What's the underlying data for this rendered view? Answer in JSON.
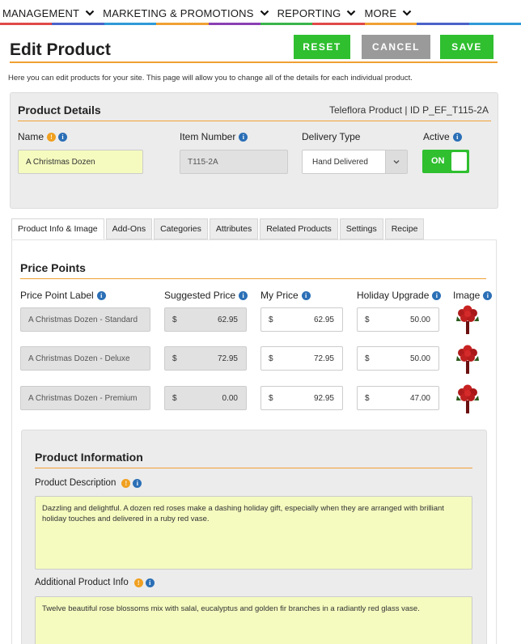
{
  "nav": {
    "items": [
      "MANAGEMENT",
      "MARKETING & PROMOTIONS",
      "REPORTING",
      "MORE"
    ],
    "colors": [
      "#e04848",
      "#4a62c8",
      "#2f9ad6",
      "#f0a033",
      "#8a3fb3",
      "#39b54a",
      "#e04848",
      "#f0a033",
      "#4a62c8",
      "#2f9ad6"
    ]
  },
  "header": {
    "title": "Edit Product",
    "reset_label": "RESET",
    "cancel_label": "CANCEL",
    "save_label": "SAVE",
    "intro": "Here you can edit products for your site. This page will allow you to change all of the details for each individual product."
  },
  "details": {
    "title": "Product Details",
    "meta": "Teleflora Product | ID P_EF_T115-2A",
    "name_label": "Name",
    "name_value": "A Christmas Dozen",
    "item_number_label": "Item Number",
    "item_number_value": "T115-2A",
    "delivery_label": "Delivery Type",
    "delivery_value": "Hand Delivered",
    "active_label": "Active",
    "active_value": "ON"
  },
  "tabs": [
    "Product Info & Image",
    "Add-Ons",
    "Categories",
    "Attributes",
    "Related Products",
    "Settings",
    "Recipe"
  ],
  "price_points": {
    "title": "Price Points",
    "headers": {
      "label": "Price Point Label",
      "suggested": "Suggested Price",
      "my_price": "My Price",
      "holiday": "Holiday Upgrade",
      "image": "Image"
    },
    "currency": "$",
    "rows": [
      {
        "label": "A Christmas Dozen - Standard",
        "suggested": "62.95",
        "my_price": "62.95",
        "holiday": "50.00"
      },
      {
        "label": "A Christmas Dozen - Deluxe",
        "suggested": "72.95",
        "my_price": "72.95",
        "holiday": "50.00"
      },
      {
        "label": "A Christmas Dozen - Premium",
        "suggested": "0.00",
        "my_price": "92.95",
        "holiday": "47.00"
      }
    ]
  },
  "product_info": {
    "title": "Product Information",
    "description_label": "Product Description",
    "description": "Dazzling and delightful. A dozen red roses make a dashing holiday gift, especially when they are arranged with brilliant holiday touches and delivered in a ruby red vase.",
    "additional_label": "Additional Product Info",
    "additional": "Twelve beautiful rose blossoms mix with salal, eucalyptus and golden fir branches in a radiantly red glass vase."
  }
}
